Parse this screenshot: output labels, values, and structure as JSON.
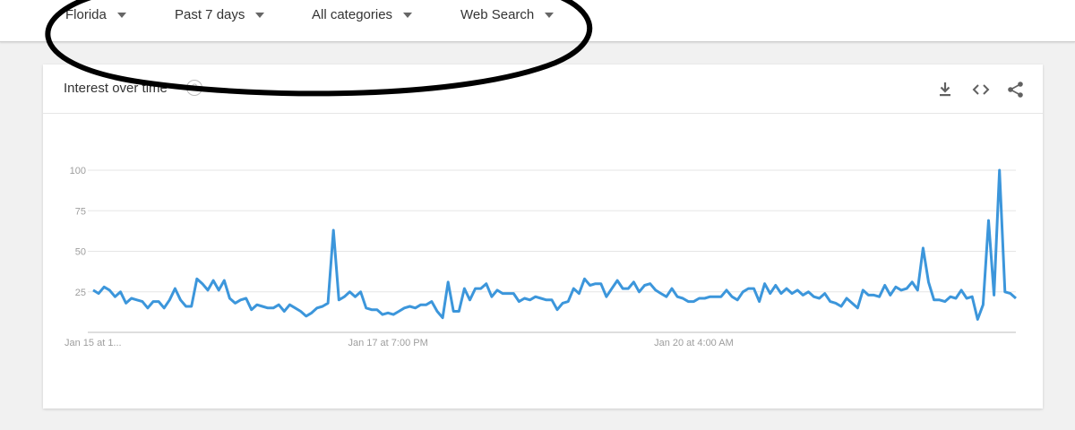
{
  "filters": [
    {
      "label": "Florida"
    },
    {
      "label": "Past 7 days"
    },
    {
      "label": "All categories"
    },
    {
      "label": "Web Search"
    }
  ],
  "card": {
    "title": "Interest over time",
    "help_icon": "help-circle-icon",
    "toolbar": [
      "download-icon",
      "embed-code-icon",
      "share-icon"
    ]
  },
  "colors": {
    "line": "#3c96db",
    "grid": "#e5e5e5",
    "axis": "#9e9e9e",
    "annotation": "#000000"
  },
  "chart_data": {
    "type": "line",
    "title": "Interest over time",
    "xlabel": "",
    "ylabel": "",
    "ylim": [
      0,
      100
    ],
    "yticks": [
      25,
      50,
      75,
      100
    ],
    "xticks": [
      "Jan 15 at 1...",
      "Jan 17 at 7:00 PM",
      "Jan 20 at 4:00 AM"
    ],
    "xtick_index": [
      0,
      54,
      110
    ],
    "grid": true,
    "series": [
      {
        "values": [
          26,
          24,
          28,
          26,
          22,
          25,
          18,
          21,
          20,
          19,
          15,
          19,
          19,
          15,
          20,
          27,
          20,
          16,
          16,
          33,
          30,
          26,
          32,
          26,
          32,
          21,
          18,
          20,
          21,
          14,
          17,
          16,
          15,
          15,
          17,
          13,
          17,
          15,
          13,
          10,
          12,
          15,
          16,
          18,
          63,
          20,
          22,
          25,
          22,
          25,
          15,
          14,
          14,
          11,
          12,
          11,
          13,
          15,
          16,
          15,
          17,
          17,
          19,
          13,
          9,
          31,
          13,
          13,
          27,
          20,
          27,
          27,
          30,
          22,
          26,
          24,
          24,
          24,
          19,
          21,
          20,
          22,
          21,
          20,
          20,
          14,
          18,
          19,
          27,
          24,
          33,
          29,
          30,
          30,
          22,
          27,
          32,
          27,
          27,
          31,
          25,
          29,
          30,
          26,
          24,
          22,
          27,
          22,
          21,
          19,
          19,
          21,
          21,
          22,
          22,
          22,
          26,
          22,
          20,
          25,
          27,
          27,
          19,
          30,
          24,
          29,
          24,
          27,
          24,
          26,
          23,
          25,
          22,
          21,
          24,
          19,
          18,
          16,
          21,
          18,
          15,
          26,
          23,
          23,
          22,
          29,
          23,
          28,
          26,
          27,
          31,
          26,
          52,
          31,
          20,
          20,
          19,
          22,
          21,
          26,
          21,
          22,
          8,
          17,
          69,
          23,
          100,
          25,
          24,
          21
        ]
      }
    ]
  }
}
